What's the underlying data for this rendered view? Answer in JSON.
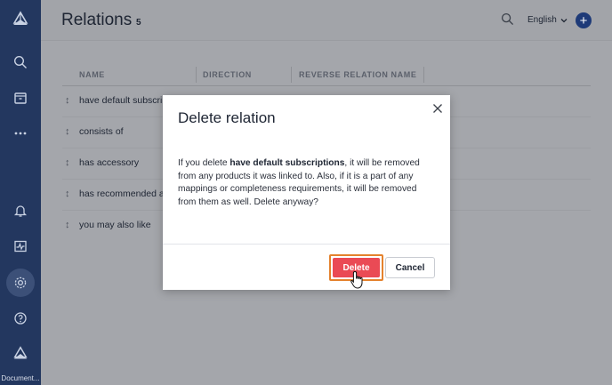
{
  "sidebar": {
    "doc_label": "Document..."
  },
  "header": {
    "title": "Relations",
    "count": "5",
    "language": "English"
  },
  "table": {
    "columns": [
      "NAME",
      "DIRECTION",
      "REVERSE RELATION NAME"
    ],
    "rows": [
      {
        "name": "have default subscrip"
      },
      {
        "name": "consists of"
      },
      {
        "name": "has accessory"
      },
      {
        "name": "has recommended ac"
      },
      {
        "name": "you may also like"
      }
    ]
  },
  "modal": {
    "title": "Delete relation",
    "body_before": "If you delete ",
    "body_bold": "have default subscriptions",
    "body_after": ", it will be removed from any products it was linked to. Also, if it is a part of any mappings or completeness requirements, it will be removed from them as well. Delete anyway?",
    "delete_label": "Delete",
    "cancel_label": "Cancel"
  },
  "colors": {
    "sidebar": "#23375f",
    "accent": "#1e3a78",
    "danger": "#ea4a55",
    "highlight": "#e4822d"
  }
}
